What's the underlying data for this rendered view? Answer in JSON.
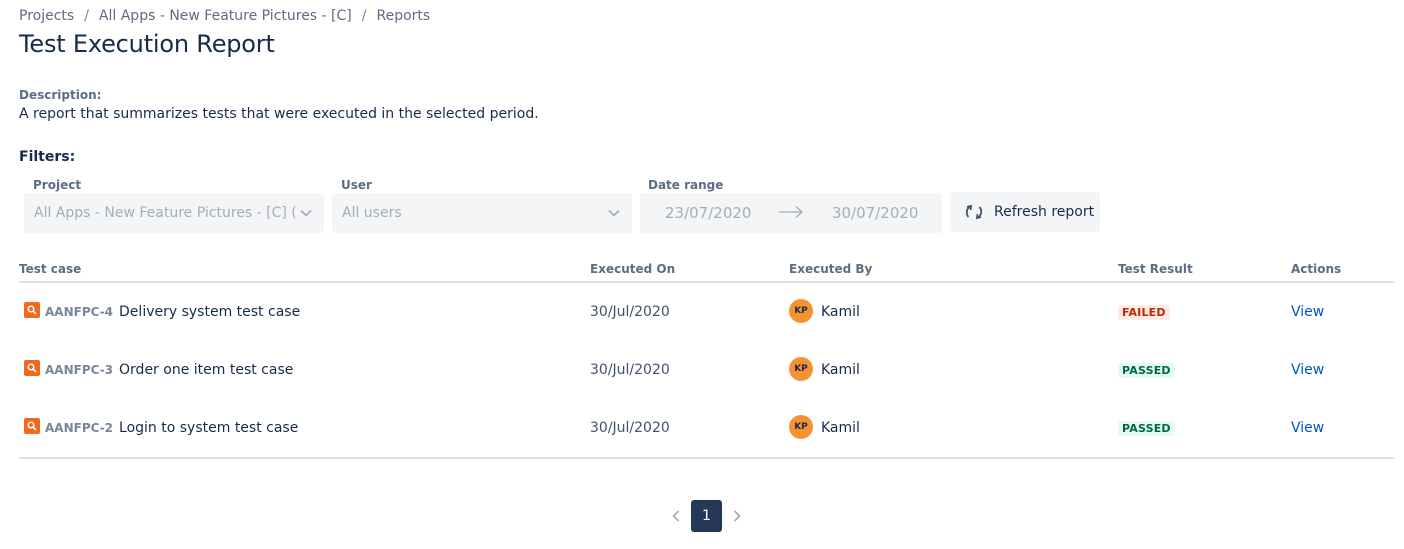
{
  "breadcrumb": {
    "items": [
      "Projects",
      "All Apps - New Feature Pictures - [C]",
      "Reports"
    ],
    "separator": "/"
  },
  "page_title": "Test Execution Report",
  "description": {
    "label": "Description:",
    "text": "A report that summarizes tests that were executed in the selected period."
  },
  "filters": {
    "label": "Filters:",
    "project": {
      "label": "Project",
      "value": "All Apps - New Feature Pictures - [C] (…"
    },
    "user": {
      "label": "User",
      "value": "All users"
    },
    "date_range": {
      "label": "Date range",
      "from": "23/07/2020",
      "to": "30/07/2020"
    },
    "refresh_label": "Refresh report"
  },
  "table": {
    "columns": [
      "Test case",
      "Executed On",
      "Executed By",
      "Test Result",
      "Actions"
    ],
    "rows": [
      {
        "key": "AANFPC-4",
        "summary": "Delivery system test case",
        "executed_on": "30/Jul/2020",
        "avatar": "KP",
        "user": "Kamil",
        "result": "FAILED",
        "action": "View"
      },
      {
        "key": "AANFPC-3",
        "summary": "Order one item test case",
        "executed_on": "30/Jul/2020",
        "avatar": "KP",
        "user": "Kamil",
        "result": "PASSED",
        "action": "View"
      },
      {
        "key": "AANFPC-2",
        "summary": "Login to system test case",
        "executed_on": "30/Jul/2020",
        "avatar": "KP",
        "user": "Kamil",
        "result": "PASSED",
        "action": "View"
      }
    ]
  },
  "pagination": {
    "current_page": "1"
  },
  "colors": {
    "failed_text": "#BF2600",
    "failed_bg": "#FFEBE6",
    "passed_text": "#006644",
    "passed_bg": "#E3FCEF",
    "link": "#0052CC",
    "test_icon": "#F06A1A",
    "avatar": "#F79232",
    "pagination_active": "#253858"
  },
  "icons": {
    "test_case": "magnifier-icon",
    "refresh": "refresh-icon",
    "dropdown": "chevron-down-icon",
    "range_arrow": "arrow-right-icon",
    "prev": "chevron-left-icon",
    "next": "chevron-right-icon"
  }
}
